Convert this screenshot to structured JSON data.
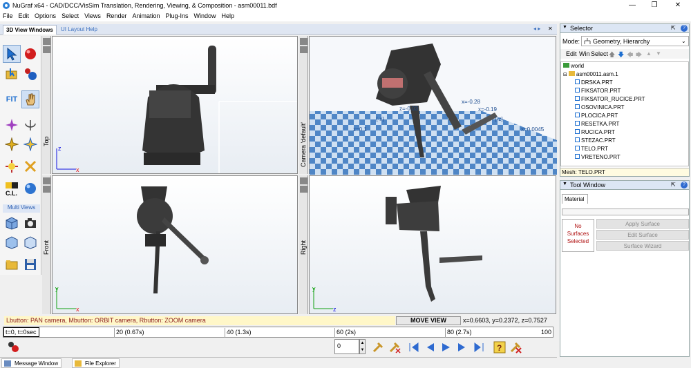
{
  "window": {
    "title": "NuGraf x64 - CAD/DCC/VisSim Translation, Rendering, Viewing, & Composition - asm00011.bdf",
    "controls": [
      "—",
      "❐",
      "✕"
    ]
  },
  "menu": [
    "File",
    "Edit",
    "Options",
    "Select",
    "Views",
    "Render",
    "Animation",
    "Plug-Ins",
    "Window",
    "Help"
  ],
  "tabs": {
    "active": "3D View Windows",
    "other": "UI Layout Help",
    "arrows": "◂ ▸",
    "close": "✕"
  },
  "toolbar": {
    "fit_label": "FIT",
    "multi_views": "Multi Views",
    "cl_label": "C.L."
  },
  "viewports": {
    "top": {
      "label": "Top"
    },
    "camera": {
      "label": "Camera 'default'",
      "overlay": [
        "z=-0.03",
        "x=-0.28",
        "x=-0.19",
        "z=0.1",
        "{-x}",
        "{-z}",
        "x=0.0045"
      ]
    },
    "front": {
      "label": "Front"
    },
    "right": {
      "label": "Right"
    }
  },
  "status": {
    "hint": "Lbutton: PAN camera, Mbutton: ORBIT camera, Rbutton: ZOOM camera",
    "mode": "MOVE VIEW",
    "coords": "x=0.6603, y=0.2372, z=0.7527"
  },
  "timeline": {
    "labels": [
      "t=0, t=0sec",
      "20 (0.67s)",
      "40 (1.3s)",
      "60 (2s)",
      "80 (2.7s)",
      "100"
    ],
    "frame": "0"
  },
  "bottom_tabs": [
    "Message Window",
    "File Explorer"
  ],
  "selector": {
    "title": "Selector",
    "mode_label": "Mode:",
    "mode_value": "Geometry, Hierarchy",
    "toolbar": [
      "Edit",
      "Win",
      "Select"
    ],
    "tree": {
      "root": "world",
      "assembly": "asm00011.asm.1",
      "parts": [
        "DRSKA.PRT",
        "FIKSATOR.PRT",
        "FIKSATOR_RUCICE.PRT",
        "OSOVINICA.PRT",
        "PLOCICA.PRT",
        "RESETKA.PRT",
        "RUCICA.PRT",
        "STEZAC.PRT",
        "TELO.PRT",
        "VRETENO.PRT"
      ]
    },
    "mesh": "Mesh: TELO.PRT"
  },
  "tool_window": {
    "title": "Tool Window",
    "tab": "Material",
    "no_surfaces": [
      "No",
      "Surfaces",
      "Selected"
    ],
    "buttons": [
      "Apply Surface",
      "Edit Surface",
      "Surface Wizard"
    ]
  },
  "colors": {
    "axis_x": "#e01010",
    "axis_y": "#10a010",
    "axis_z": "#1010e0",
    "status_bg": "#fff7c8",
    "status_text": "#8c1c1c",
    "accent_blue": "#3a6fbf"
  }
}
